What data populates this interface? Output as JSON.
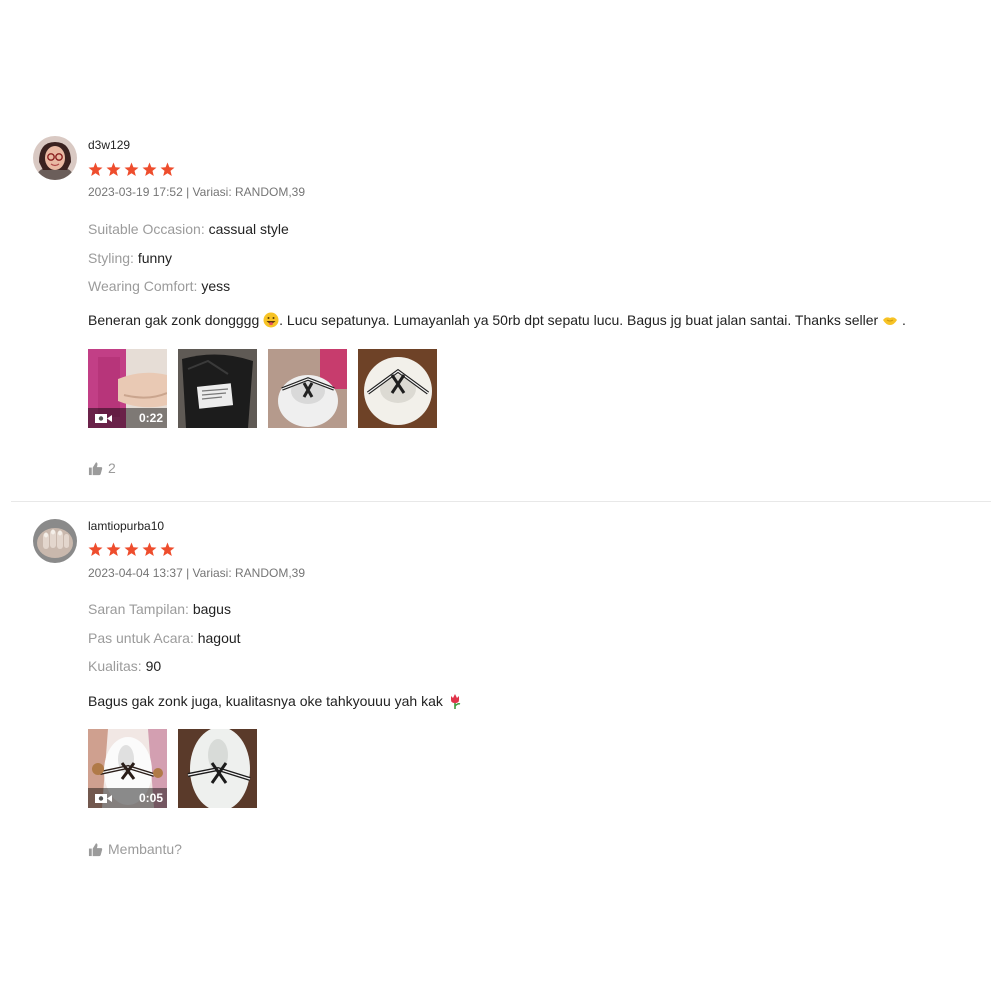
{
  "colors": {
    "star": "#ee4d2d",
    "muted": "#9b9b9b",
    "meta": "#757575",
    "text": "#222222"
  },
  "reviews": [
    {
      "username": "d3w129",
      "rating": 5,
      "meta": "2023-03-19 17:52 | Variasi: RANDOM,39",
      "attributes": [
        {
          "label": "Suitable Occasion:",
          "value": "cassual style"
        },
        {
          "label": "Styling:",
          "value": "funny"
        },
        {
          "label": "Wearing Comfort:",
          "value": "yess"
        }
      ],
      "comment_parts": [
        "Beneran gak zonk dongggg ",
        ". Lucu sepatunya. Lumayanlah ya 50rb dpt sepatu lucu. Bagus jg buat jalan santai. Thanks seller ",
        " ."
      ],
      "media": [
        {
          "type": "video",
          "duration": "0:22"
        },
        {
          "type": "image"
        },
        {
          "type": "image"
        },
        {
          "type": "image"
        }
      ],
      "helpful_text": "2"
    },
    {
      "username": "lamtiopurba10",
      "rating": 5,
      "meta": "2023-04-04 13:37 | Variasi: RANDOM,39",
      "attributes": [
        {
          "label": "Saran Tampilan:",
          "value": "bagus"
        },
        {
          "label": "Pas untuk Acara:",
          "value": "hagout"
        },
        {
          "label": "Kualitas:",
          "value": "90"
        }
      ],
      "comment_parts": [
        "Bagus gak zonk juga, kualitasnya oke tahkyouuu yah kak "
      ],
      "media": [
        {
          "type": "video",
          "duration": "0:05"
        },
        {
          "type": "image"
        }
      ],
      "helpful_text": "Membantu?"
    }
  ]
}
